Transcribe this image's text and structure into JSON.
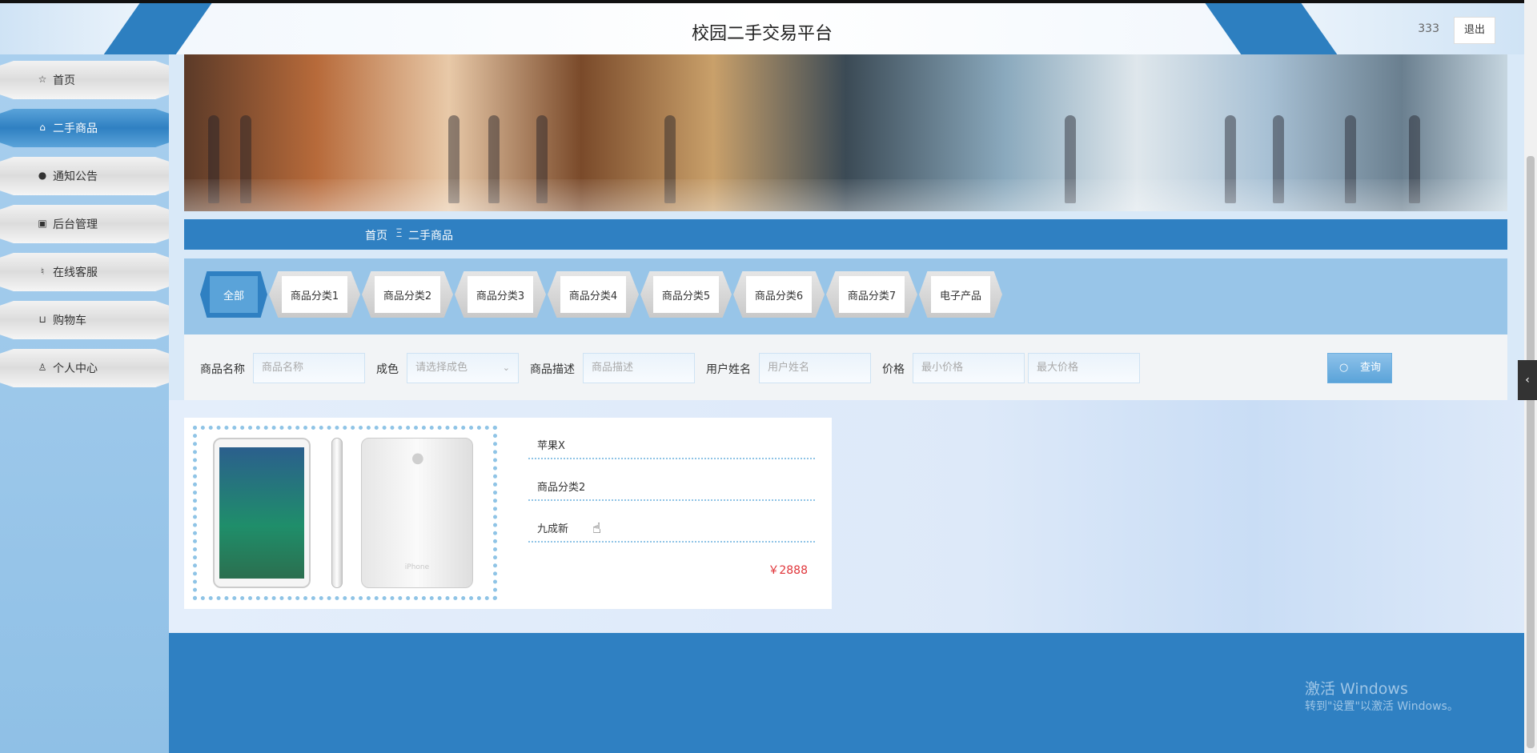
{
  "header": {
    "title": "校园二手交易平台",
    "username": "333",
    "logout_label": "退出"
  },
  "sidebar": {
    "items": [
      {
        "label": "首页",
        "icon": "star-icon",
        "glyph": "☆"
      },
      {
        "label": "二手商品",
        "icon": "bag-icon",
        "glyph": "⌂"
      },
      {
        "label": "通知公告",
        "icon": "alert-icon",
        "glyph": "●"
      },
      {
        "label": "后台管理",
        "icon": "box-icon",
        "glyph": "▣"
      },
      {
        "label": "在线客服",
        "icon": "headset-icon",
        "glyph": "♮"
      },
      {
        "label": "购物车",
        "icon": "cart-icon",
        "glyph": "⊔"
      },
      {
        "label": "个人中心",
        "icon": "user-icon",
        "glyph": "♙"
      }
    ],
    "active_index": 1
  },
  "breadcrumb": {
    "home": "首页",
    "separator": "Ξ",
    "current": "二手商品"
  },
  "categories": [
    "全部",
    "商品分类1",
    "商品分类2",
    "商品分类3",
    "商品分类4",
    "商品分类5",
    "商品分类6",
    "商品分类7",
    "电子产品"
  ],
  "filter": {
    "name_label": "商品名称",
    "name_placeholder": "商品名称",
    "condition_label": "成色",
    "condition_placeholder": "请选择成色",
    "desc_label": "商品描述",
    "desc_placeholder": "商品描述",
    "user_label": "用户姓名",
    "user_placeholder": "用户姓名",
    "price_label": "价格",
    "min_placeholder": "最小价格",
    "max_placeholder": "最大价格",
    "search_label": "查询"
  },
  "products": [
    {
      "name": "苹果X",
      "category": "商品分类2",
      "condition": "九成新",
      "price": "￥2888"
    }
  ],
  "watermark": {
    "line1": "激活 Windows",
    "line2": "转到\"设置\"以激活 Windows。"
  },
  "colors": {
    "primary": "#2f80c2",
    "price": "#e0353a"
  }
}
